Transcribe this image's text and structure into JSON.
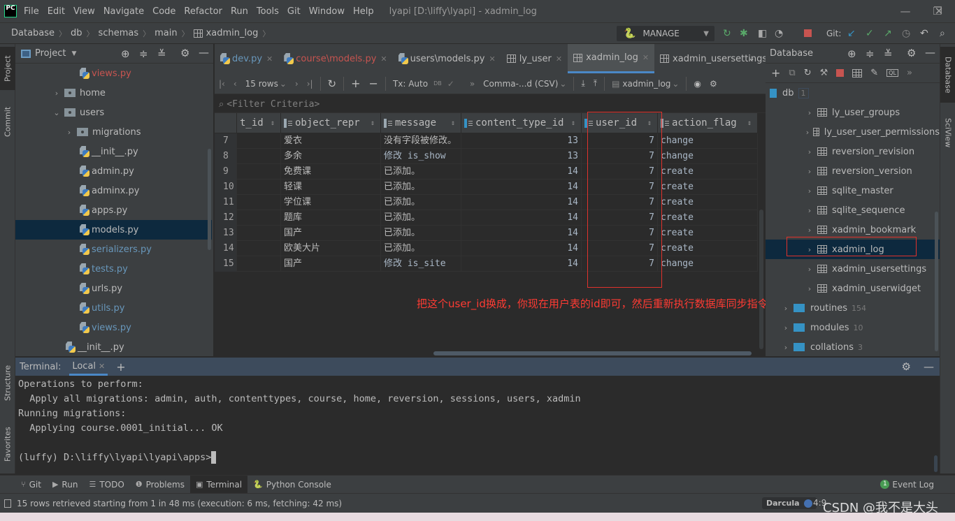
{
  "menubar": {
    "logo": "PC",
    "items": [
      "File",
      "Edit",
      "View",
      "Navigate",
      "Code",
      "Refactor",
      "Run",
      "Tools",
      "Git",
      "Window",
      "Help"
    ],
    "window_title": "lyapi [D:\\liffy\\lyapi] - xadmin_log"
  },
  "navbar": {
    "breadcrumb": [
      "Database",
      "db",
      "schemas",
      "main",
      "xadmin_log"
    ],
    "run_config": "MANAGE",
    "git_label": "Git:"
  },
  "left_strip": {
    "project": "Project",
    "commit": "Commit",
    "structure": "Structure",
    "favorites": "Favorites"
  },
  "project_panel": {
    "title": "Project",
    "tree": [
      {
        "label": "views.py",
        "type": "py",
        "indent": 3,
        "color": "#c75450"
      },
      {
        "label": "home",
        "type": "folder",
        "indent": 2,
        "expanded": false
      },
      {
        "label": "users",
        "type": "folder",
        "indent": 2,
        "expanded": true
      },
      {
        "label": "migrations",
        "type": "folder",
        "indent": 3,
        "expanded": false
      },
      {
        "label": "__init__.py",
        "type": "py",
        "indent": 3,
        "color": "#bbbbbb"
      },
      {
        "label": "admin.py",
        "type": "py",
        "indent": 3,
        "color": "#bbbbbb"
      },
      {
        "label": "adminx.py",
        "type": "py",
        "indent": 3,
        "color": "#bbbbbb"
      },
      {
        "label": "apps.py",
        "type": "py",
        "indent": 3,
        "color": "#bbbbbb"
      },
      {
        "label": "models.py",
        "type": "py",
        "indent": 3,
        "color": "#bbbbbb",
        "selected": true
      },
      {
        "label": "serializers.py",
        "type": "py",
        "indent": 3,
        "color": "#6897bb"
      },
      {
        "label": "tests.py",
        "type": "py",
        "indent": 3,
        "color": "#6897bb"
      },
      {
        "label": "urls.py",
        "type": "py",
        "indent": 3,
        "color": "#bbbbbb"
      },
      {
        "label": "utils.py",
        "type": "py",
        "indent": 3,
        "color": "#6897bb"
      },
      {
        "label": "views.py",
        "type": "py",
        "indent": 3,
        "color": "#6897bb"
      },
      {
        "label": "__init__.py",
        "type": "py",
        "indent": 2,
        "color": "#bbbbbb"
      }
    ]
  },
  "editor_tabs": [
    {
      "label": "dev.py",
      "icon": "python-file",
      "color": "#6897bb"
    },
    {
      "label": "course\\models.py",
      "icon": "python-file",
      "color": "#c75450"
    },
    {
      "label": "users\\models.py",
      "icon": "python-file",
      "color": "#bbbbbb"
    },
    {
      "label": "ly_user",
      "icon": "table",
      "color": "#bbbbbb"
    },
    {
      "label": "xadmin_log",
      "icon": "table",
      "color": "#bbbbbb",
      "active": true
    },
    {
      "label": "xadmin_usersettings",
      "icon": "table",
      "color": "#bbbbbb"
    }
  ],
  "grid_toolbar": {
    "rows": "15 rows",
    "tx": "Tx: Auto",
    "db_label": "DB",
    "format": "Comma-...d (CSV)",
    "table": "xadmin_log"
  },
  "filter": {
    "placeholder": "<Filter Criteria>"
  },
  "grid": {
    "columns": [
      {
        "label": "t_id",
        "icon": "none"
      },
      {
        "label": "object_repr",
        "icon": "column"
      },
      {
        "label": "message",
        "icon": "column"
      },
      {
        "label": "content_type_id",
        "icon": "key-column"
      },
      {
        "label": "user_id",
        "icon": "key-column"
      },
      {
        "label": "action_flag",
        "icon": "column"
      }
    ],
    "rows": [
      {
        "n": "7",
        "t_id": "",
        "object_repr": "爱衣",
        "message": "没有字段被修改。",
        "content_type_id": "13",
        "user_id": "7",
        "action_flag": "change"
      },
      {
        "n": "8",
        "t_id": "",
        "object_repr": "多余",
        "message": "修改 is_show",
        "content_type_id": "13",
        "user_id": "7",
        "action_flag": "change"
      },
      {
        "n": "9",
        "t_id": "",
        "object_repr": "免费课",
        "message": "已添加。",
        "content_type_id": "14",
        "user_id": "7",
        "action_flag": "create"
      },
      {
        "n": "10",
        "t_id": "",
        "object_repr": "轻课",
        "message": "已添加。",
        "content_type_id": "14",
        "user_id": "7",
        "action_flag": "create"
      },
      {
        "n": "11",
        "t_id": "",
        "object_repr": "学位课",
        "message": "已添加。",
        "content_type_id": "14",
        "user_id": "7",
        "action_flag": "create"
      },
      {
        "n": "12",
        "t_id": "",
        "object_repr": "题库",
        "message": "已添加。",
        "content_type_id": "14",
        "user_id": "7",
        "action_flag": "create"
      },
      {
        "n": "13",
        "t_id": "",
        "object_repr": "国产",
        "message": "已添加。",
        "content_type_id": "14",
        "user_id": "7",
        "action_flag": "create"
      },
      {
        "n": "14",
        "t_id": "",
        "object_repr": "欧美大片",
        "message": "已添加。",
        "content_type_id": "14",
        "user_id": "7",
        "action_flag": "create"
      },
      {
        "n": "15",
        "t_id": "",
        "object_repr": "国产",
        "message": "修改 is_site",
        "content_type_id": "14",
        "user_id": "7",
        "action_flag": "change"
      }
    ]
  },
  "annotation": {
    "text": "把这个user_id换成，你现在用户表的id即可，然后重新执行数据库同步指令",
    "color": "#ff3b33"
  },
  "db_panel": {
    "title": "Database",
    "root": "db",
    "root_count": "1",
    "tables": [
      "ly_user_groups",
      "ly_user_user_permissions",
      "reversion_revision",
      "reversion_version",
      "sqlite_master",
      "sqlite_sequence",
      "xadmin_bookmark",
      "xadmin_log",
      "xadmin_usersettings",
      "xadmin_userwidget"
    ],
    "selected_table": "xadmin_log",
    "folders": [
      {
        "label": "routines",
        "count": "154"
      },
      {
        "label": "modules",
        "count": "10"
      },
      {
        "label": "collations",
        "count": "3"
      }
    ]
  },
  "right_strip": {
    "database": "Database",
    "sciview": "SciView"
  },
  "terminal": {
    "label": "Terminal:",
    "tab": "Local",
    "lines": [
      "Operations to perform:",
      "  Apply all migrations: admin, auth, contenttypes, course, home, reversion, sessions, users, xadmin",
      "Running migrations:",
      "  Applying course.0001_initial... OK",
      ""
    ],
    "prompt": "(luffy) D:\\liffy\\lyapi\\lyapi\\apps>"
  },
  "bottom_tabs": [
    {
      "label": "Git",
      "icon": "git-icon"
    },
    {
      "label": "Run",
      "icon": "run-icon"
    },
    {
      "label": "TODO",
      "icon": "todo-icon"
    },
    {
      "label": "Problems",
      "icon": "problems-icon"
    },
    {
      "label": "Terminal",
      "icon": "terminal-icon",
      "active": true
    },
    {
      "label": "Python Console",
      "icon": "python-icon"
    }
  ],
  "event_log": {
    "count": "1",
    "label": "Event Log"
  },
  "statusbar": {
    "message": "15 rows retrieved starting from 1 in 48 ms (execution: 6 ms, fetching: 42 ms)",
    "theme": "Darcula",
    "position": "4:9"
  },
  "watermark": "CSDN @我不是大头"
}
